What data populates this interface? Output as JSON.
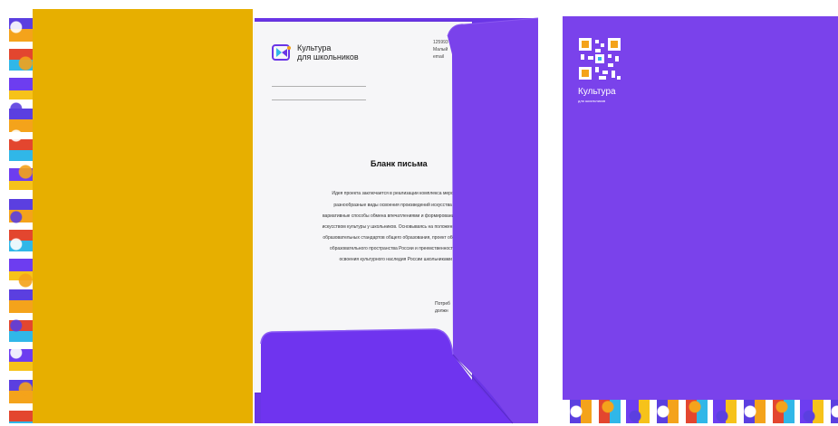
{
  "colors": {
    "yellow": "#e7af00",
    "purple": "#7a42eb",
    "purple_dark": "#6a35e6",
    "paper": "#f6f6f8"
  },
  "letter": {
    "brand_line1": "Культура",
    "brand_line2": "для школьников",
    "address_lines": [
      "125993",
      "Малый",
      "email"
    ],
    "title": "Бланк письма",
    "body_lines": [
      "Идея проекта заключается в реализации комплекса мероприятий,",
      "разнообразные виды освоения произведений искусства и художе",
      "вариативные способы обмена впечатлениями и формирования собств",
      "искусством культуры у школьников. Основываясь на положениях Феде",
      "образовательных стандартов общего образования, проект обеспечива",
      "образовательного пространства России и преемственность содерж",
      "освоения культурного наследия России школьниками разных в"
    ],
    "sign_lines": [
      "Потреб",
      "должн"
    ]
  },
  "folder_right": {
    "brand_line1": "Культура",
    "brand_line2": "для школьников",
    "qr_icon": "qr-code-icon"
  }
}
